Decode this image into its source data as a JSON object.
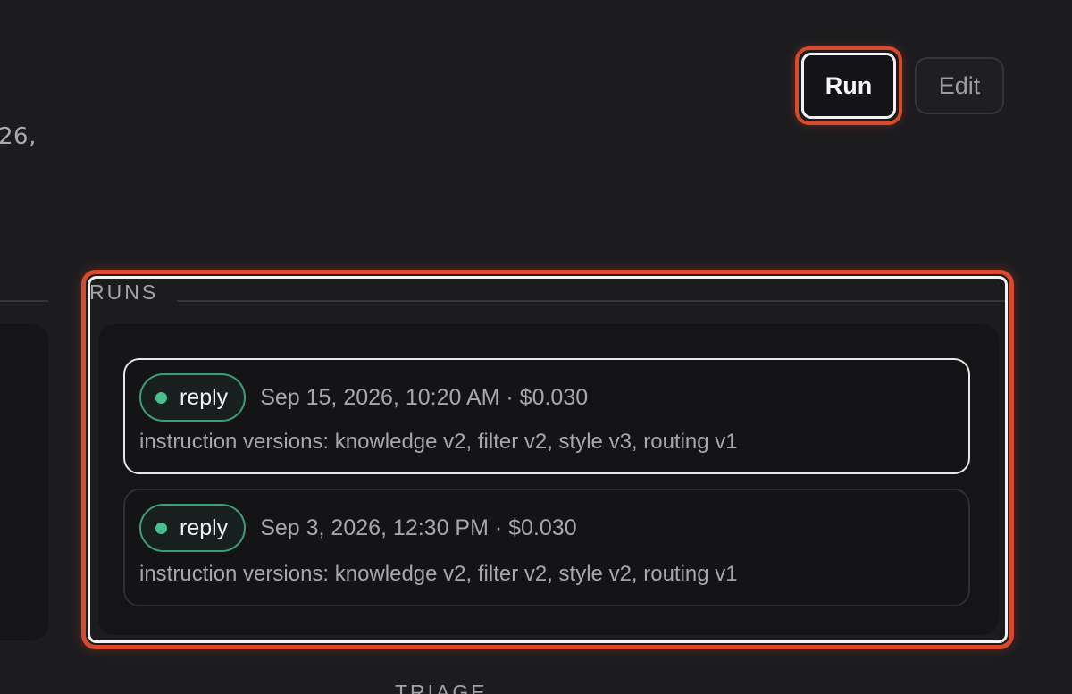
{
  "header": {
    "left_fragment": "26,",
    "run_label": "Run",
    "edit_label": "Edit"
  },
  "runs": {
    "title": "RUNS",
    "items": [
      {
        "status": "reply",
        "status_color": "#46c08e",
        "meta": "Sep 15, 2026, 10:20 AM · $0.030",
        "versions": "instruction versions: knowledge v2, filter v2, style v3, routing v1",
        "selected": true
      },
      {
        "status": "reply",
        "status_color": "#46c08e",
        "meta": "Sep 3, 2026, 12:30 PM · $0.030",
        "versions": "instruction versions: knowledge v2, filter v2, style v2, routing v1",
        "selected": false
      }
    ]
  },
  "triage": {
    "title": "TRIAGE"
  },
  "colors": {
    "background": "#1c1c1f",
    "highlight": "#d9492c",
    "status_green": "#46c08e"
  }
}
